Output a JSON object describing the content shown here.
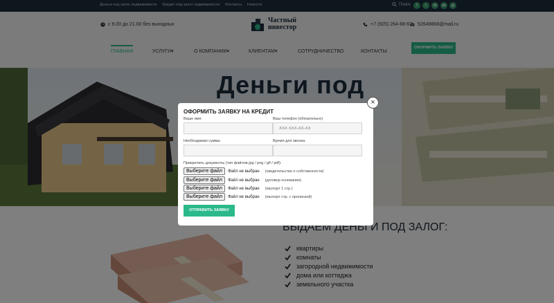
{
  "topbar": {
    "links": [
      "Деньги под залог недвижимости",
      "Кредит под залог недвижимости",
      "Контакты",
      "Новости"
    ],
    "search_label": "Поиск",
    "socials": [
      "facebook-icon",
      "twitter-icon",
      "vk-icon",
      "odnoklassniki-icon",
      "instagram-icon"
    ]
  },
  "header": {
    "hours": "с 9.00 до 21.00 без выходных",
    "logo_line1": "Частный",
    "logo_line2": "инвестор",
    "phone": "+7 (925) 264-88-63",
    "email": "52648868@mail.ru"
  },
  "nav": {
    "items": [
      "Главная",
      "Услуги",
      "О компании",
      "Клиентам",
      "Сотрудничество",
      "Контакты"
    ],
    "order_button": "Оформить заявку"
  },
  "hero": {
    "title": "Деньги под"
  },
  "lower": {
    "title": "Выдаем деньги под залог:",
    "items": [
      "квартиры",
      "комнаты",
      "загородной недвижимости",
      "дома или коттеджа",
      "земельного участка"
    ]
  },
  "modal": {
    "title": "Оформить заявку на кредит",
    "name_label": "Ваше имя",
    "name_value": "",
    "phone_label": "Ваш телефон (обязательно)",
    "phone_placeholder": "XXX XXX-XX-XX",
    "amount_label": "Необходимая сумма:",
    "amount_value": "",
    "time_label": "Время для звонка:",
    "time_value": "",
    "attach_label": "Прикрепить документы (тип файлов jpg / png / gif / pdf):",
    "file_button": "Выберите файл",
    "file_status": "Файл не выбран",
    "files": [
      "(свидетельство о собственности)",
      "(договор основания)",
      "(паспорт 1 стр.)",
      "(паспорт стр. с пропиской)"
    ],
    "submit": "Отправить заявку",
    "close": "×"
  },
  "colors": {
    "accent": "#2bb98b",
    "dark": "#1d2d3c"
  }
}
